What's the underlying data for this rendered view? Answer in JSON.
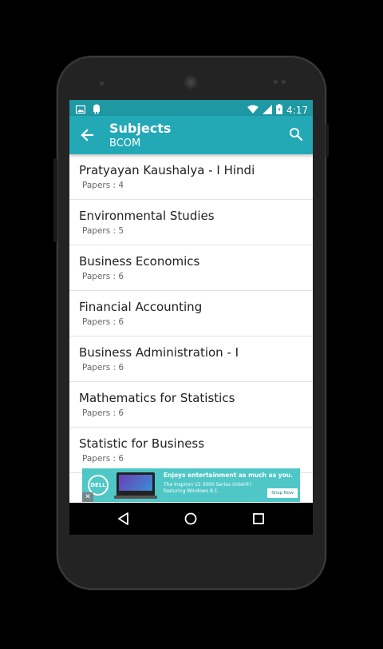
{
  "status_bar": {
    "time": "4:17",
    "left_icons": [
      "image-icon",
      "android-icon"
    ],
    "right_icons": [
      "wifi-icon",
      "cell-signal-icon",
      "battery-icon"
    ]
  },
  "app_bar": {
    "title": "Subjects",
    "subtitle": "BCOM",
    "back_icon": "arrow-left-icon",
    "search_icon": "search-icon"
  },
  "subjects": [
    {
      "title": "Pratyayan Kaushalya - I Hindi",
      "papers": "Papers : 4"
    },
    {
      "title": "Environmental Studies",
      "papers": "Papers : 5"
    },
    {
      "title": "Business Economics",
      "papers": "Papers : 6"
    },
    {
      "title": "Financial Accounting",
      "papers": "Papers : 6"
    },
    {
      "title": "Business Administration - I",
      "papers": "Papers : 6"
    },
    {
      "title": "Mathematics for Statistics",
      "papers": "Papers : 6"
    },
    {
      "title": "Statistic for Business",
      "papers": "Papers : 6"
    }
  ],
  "ad": {
    "logo": "DELL",
    "headline": "Enjoys entertainment as much as you.",
    "body": "The Inspiron 15 3000 Series (Intel®) featuring Windows 8.1.",
    "cta": "Shop Now",
    "close": "✕"
  },
  "nav_bar": {
    "buttons": [
      "back-triangle-icon",
      "home-circle-icon",
      "recents-square-icon"
    ]
  },
  "colors": {
    "status_bar": "#1e98a3",
    "app_bar": "#23a9b6",
    "ad_background": "#4fc7c6"
  }
}
